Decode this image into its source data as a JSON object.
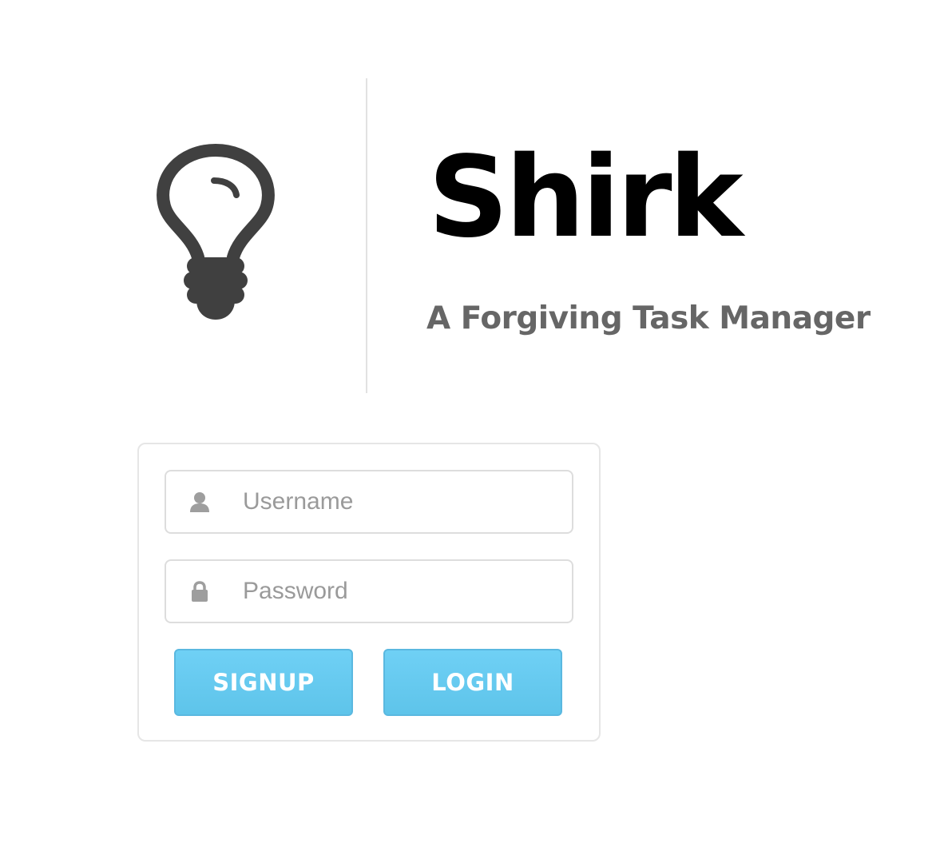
{
  "branding": {
    "title": "Shirk",
    "tagline": "A Forgiving Task Manager",
    "logo_icon": "lightbulb-icon"
  },
  "login_form": {
    "username": {
      "icon": "user-icon",
      "placeholder": "Username",
      "value": ""
    },
    "password": {
      "icon": "lock-icon",
      "placeholder": "Password",
      "value": ""
    },
    "signup_label": "SIGNUP",
    "login_label": "LOGIN"
  },
  "colors": {
    "icon": "#404040",
    "title": "#000000",
    "tagline": "#666666",
    "button": "#6dcbf0",
    "placeholder": "#9a9a9a"
  }
}
